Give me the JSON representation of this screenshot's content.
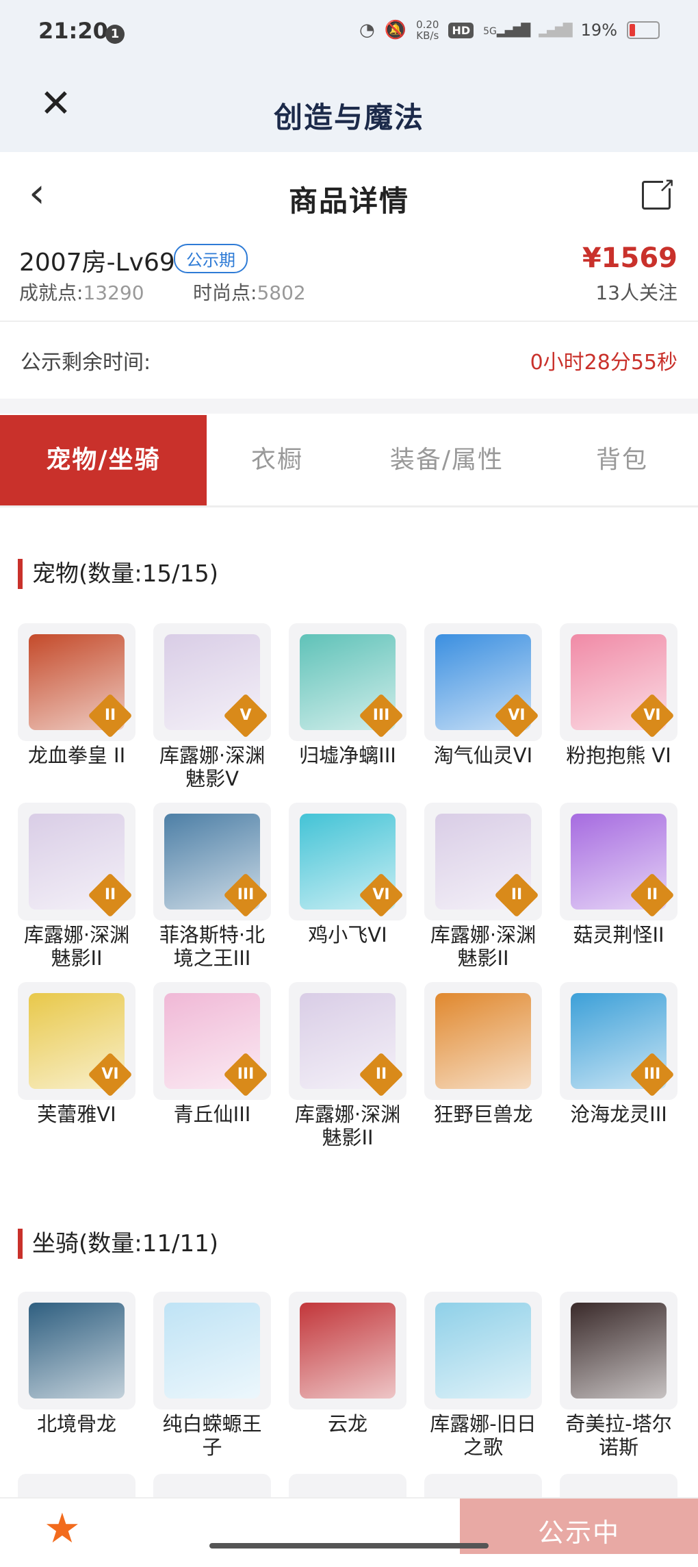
{
  "status_bar": {
    "time": "21:20",
    "notif_count": "1",
    "speed_top": "0.20",
    "speed_bottom": "KB/s",
    "hd": "HD",
    "network": "5G",
    "battery": "19%",
    "battery_level": 0.19
  },
  "app": {
    "title": "创造与魔法",
    "close_icon": "close-icon"
  },
  "header": {
    "title": "商品详情",
    "back_icon": "chevron-left-icon",
    "share_icon": "share-icon"
  },
  "item": {
    "name": "2007房-Lv69",
    "badge": "公示期",
    "achievement_label": "成就点:",
    "achievement_value": "13290",
    "fashion_label": "时尚点:",
    "fashion_value": "5802",
    "price": "¥1569",
    "followers": "13人关注"
  },
  "countdown": {
    "label": "公示剩余时间:",
    "value": "0小时28分55秒"
  },
  "tabs": [
    {
      "label": "宠物/坐骑",
      "active": true
    },
    {
      "label": "衣橱",
      "active": false
    },
    {
      "label": "装备/属性",
      "active": false
    },
    {
      "label": "背包",
      "active": false
    }
  ],
  "pets": {
    "title": "宠物(数量:15/15)",
    "items": [
      {
        "label": "龙血拳皇 II",
        "rank": "II",
        "color": "#c44a2a"
      },
      {
        "label": "库露娜·深渊魅影V",
        "rank": "V",
        "color": "#d9cde6"
      },
      {
        "label": "归墟净螭III",
        "rank": "III",
        "color": "#5fc2b8"
      },
      {
        "label": "淘气仙灵VI",
        "rank": "VI",
        "color": "#3b8fe0"
      },
      {
        "label": "粉抱抱熊 VI",
        "rank": "VI",
        "color": "#f08aa6"
      },
      {
        "label": "库露娜·深渊魅影II",
        "rank": "II",
        "color": "#d9cde6"
      },
      {
        "label": "菲洛斯特·北境之王III",
        "rank": "III",
        "color": "#4d7fa6"
      },
      {
        "label": "鸡小飞VI",
        "rank": "VI",
        "color": "#43c3d6"
      },
      {
        "label": "库露娜·深渊魅影II",
        "rank": "II",
        "color": "#d9cde6"
      },
      {
        "label": "菇灵荆怪II",
        "rank": "II",
        "color": "#a66be0"
      },
      {
        "label": "芙蕾雅VI",
        "rank": "VI",
        "color": "#e8c84a"
      },
      {
        "label": "青丘仙III",
        "rank": "III",
        "color": "#f0b8d6"
      },
      {
        "label": "库露娜·深渊魅影II",
        "rank": "II",
        "color": "#d9cde6"
      },
      {
        "label": "狂野巨兽龙",
        "rank": "",
        "color": "#e0882e"
      },
      {
        "label": "沧海龙灵III",
        "rank": "III",
        "color": "#3da0d8"
      }
    ]
  },
  "mounts": {
    "title": "坐骑(数量:11/11)",
    "items": [
      {
        "label": "北境骨龙",
        "rank": "",
        "color": "#2f5f80"
      },
      {
        "label": "纯白蝾螈王子",
        "rank": "",
        "color": "#bfe3f5"
      },
      {
        "label": "云龙",
        "rank": "",
        "color": "#c2363a"
      },
      {
        "label": "库露娜-旧日之歌",
        "rank": "",
        "color": "#8fd0e8"
      },
      {
        "label": "奇美拉-塔尔诺斯",
        "rank": "",
        "color": "#3a2a2a"
      }
    ]
  },
  "bottom": {
    "cta": "公示中",
    "fav_icon": "star-icon"
  }
}
